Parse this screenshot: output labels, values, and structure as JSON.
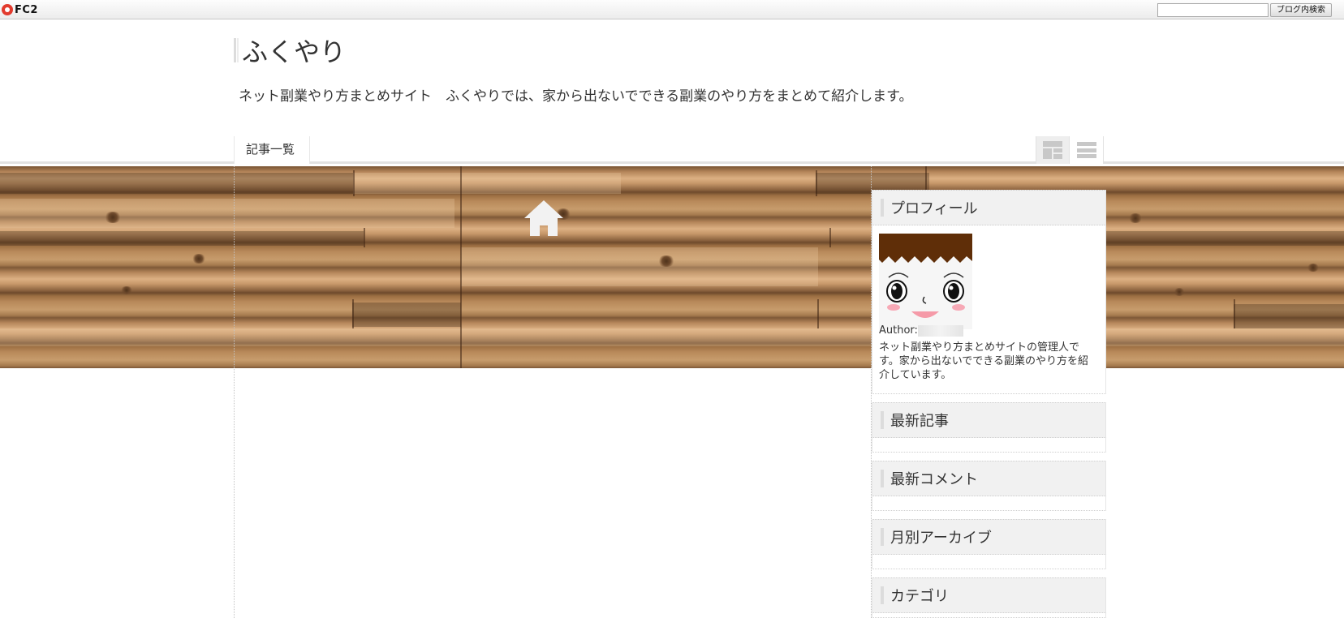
{
  "fc2bar": {
    "logo_text": "FC2",
    "search_value": "",
    "search_button": "ブログ内検索"
  },
  "blog": {
    "title": "ふくやり",
    "description": "ネット副業やり方まとめサイト　ふくやりでは、家から出ないでできる副業のやり方をまとめて紹介します。"
  },
  "nav": {
    "tab_label": "記事一覧"
  },
  "sidebar": {
    "profile": {
      "title": "プロフィール",
      "author_label": "Author:",
      "description": "ネット副業やり方まとめサイトの管理人です。家から出ないでできる副業のやり方を紹介しています。"
    },
    "widgets": [
      {
        "title": "最新記事"
      },
      {
        "title": "最新コメント"
      },
      {
        "title": "月別アーカイブ"
      },
      {
        "title": "カテゴリ"
      }
    ]
  }
}
